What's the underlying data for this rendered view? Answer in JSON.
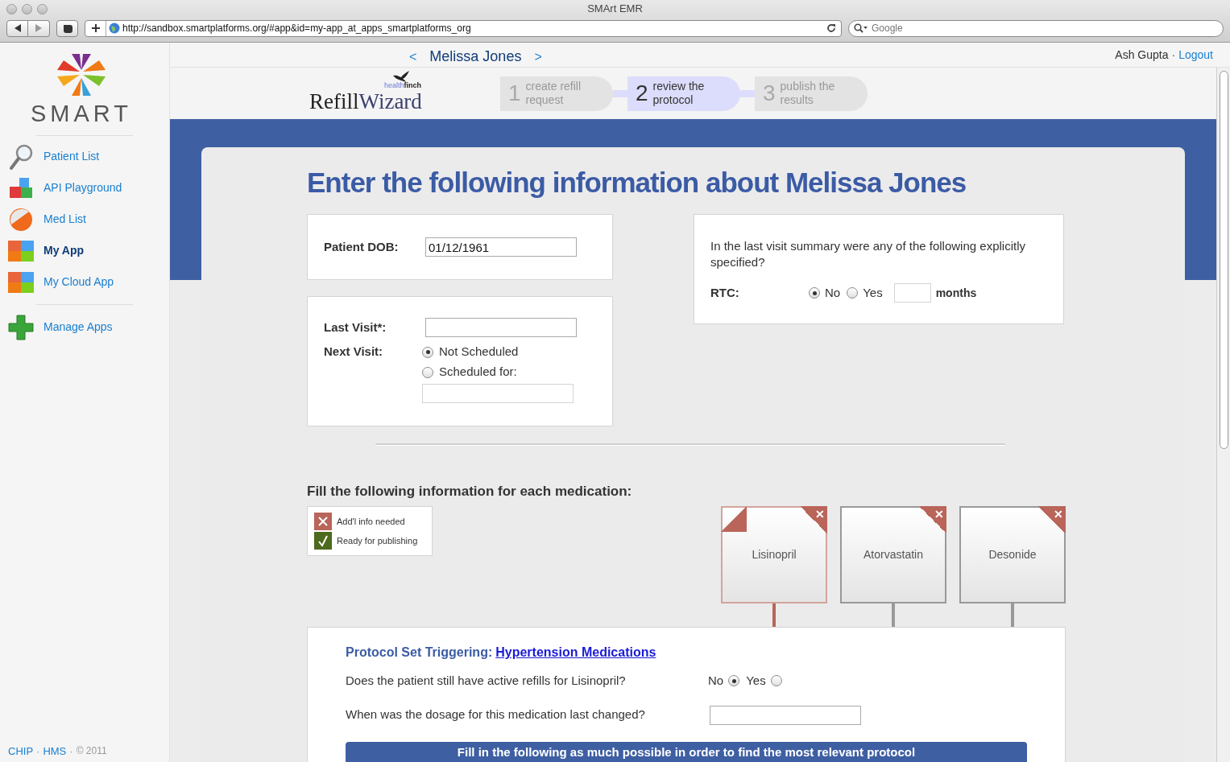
{
  "browser": {
    "title": "SMArt EMR",
    "url": "http://sandbox.smartplatforms.org/#app&id=my-app_at_apps_smartplatforms_org",
    "search_placeholder": "Google"
  },
  "sidebar": {
    "brand": "SMART",
    "items": [
      {
        "kind": "search",
        "label": "Patient List",
        "selected": false
      },
      {
        "kind": "blocks",
        "label": "API Playground",
        "selected": false
      },
      {
        "kind": "ball",
        "label": "Med List",
        "selected": false
      },
      {
        "kind": "tiles",
        "label": "My App",
        "selected": true
      },
      {
        "kind": "tiles",
        "label": "My Cloud App",
        "selected": false
      },
      {
        "kind": "plus",
        "label": "Manage Apps",
        "selected": false
      }
    ],
    "footer": {
      "links": [
        "CHIP",
        "HMS"
      ],
      "separator": "·",
      "copyright": "© 2011"
    }
  },
  "header": {
    "prev": "<",
    "patient": "Melissa Jones",
    "next": ">",
    "user": "Ash Gupta",
    "separator": "·",
    "logout": "Logout"
  },
  "wizard": {
    "logo_word1": "Refill",
    "logo_word2": "Wizard",
    "logo_tag1": "health",
    "logo_tag2": "finch",
    "steps": [
      {
        "number": "1",
        "label": "create refill request",
        "selected": false
      },
      {
        "number": "2",
        "label": "review the protocol",
        "selected": true
      },
      {
        "number": "3",
        "label": "publish the results",
        "selected": false
      }
    ]
  },
  "form": {
    "heading": "Enter the following information about Melissa Jones",
    "dob": {
      "label": "Patient DOB:",
      "value": "01/12/1961"
    },
    "last_visit": {
      "label": "Last Visit*:"
    },
    "next_visit": {
      "label": "Next Visit:",
      "options": [
        {
          "label": "Not Scheduled",
          "selected": true
        },
        {
          "label": "Scheduled for:",
          "selected": false
        }
      ]
    },
    "summary": {
      "question": "In the last visit summary were any of the following explicitly specified?",
      "rtc_label": "RTC:",
      "options": [
        {
          "label": "No",
          "selected": true
        },
        {
          "label": "Yes",
          "selected": false
        }
      ],
      "unit": "months"
    }
  },
  "medications": {
    "heading": "Fill the following information for each medication:",
    "legend": [
      {
        "kind": "needed",
        "label": "Add'l info needed"
      },
      {
        "kind": "ready",
        "label": "Ready for publishing"
      }
    ],
    "items": [
      {
        "name": "Lisinopril",
        "selected": true,
        "close": "✕"
      },
      {
        "name": "Atorvastatin",
        "selected": false,
        "close": "✕"
      },
      {
        "name": "Desonide",
        "selected": false,
        "close": "✕"
      }
    ]
  },
  "protocol": {
    "label": "Protocol Set Triggering:",
    "link": "Hypertension Medications",
    "refill_question": "Does the patient still have active refills for Lisinopril?",
    "refill_options": [
      {
        "label": "No",
        "selected": true
      },
      {
        "label": "Yes",
        "selected": false
      }
    ],
    "dosage_question": "When was the dosage for this medication last changed?",
    "button": "Fill in the following as much possible in order to find the most relevant protocol"
  }
}
